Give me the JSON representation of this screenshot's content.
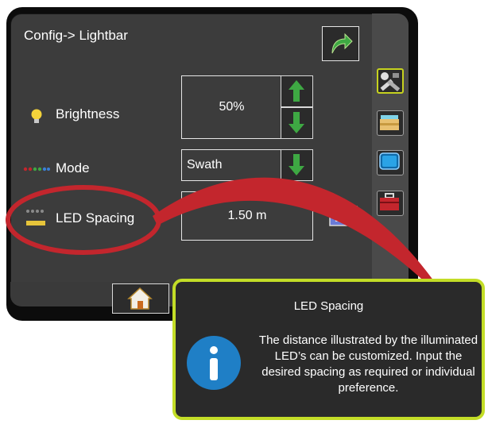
{
  "header": {
    "title": "Config-> Lightbar"
  },
  "settings": {
    "brightness": {
      "label": "Brightness",
      "value": "50%"
    },
    "mode": {
      "label": "Mode",
      "value": "Swath"
    },
    "led_spacing": {
      "label": "LED Spacing",
      "value": "1.50 m"
    }
  },
  "callout": {
    "title": "LED Spacing",
    "body": "The distance illustrated by the illuminated LED’s can be customized. Input the desired spacing as required or individual preference."
  },
  "icons": {
    "return": "return-arrow-icon",
    "up": "up-arrow-icon",
    "down": "down-arrow-icon",
    "keyboard": "keyboard-icon",
    "home": "home-icon",
    "info": "info-icon",
    "tabs": [
      "tools-icon",
      "folder-icon",
      "monitor-icon",
      "toolbox-icon"
    ]
  },
  "colors": {
    "accent": "#c3dd27",
    "arrow_green": "#3ea843",
    "highlight_red": "#c3262d",
    "info_blue": "#1f7fc6"
  }
}
